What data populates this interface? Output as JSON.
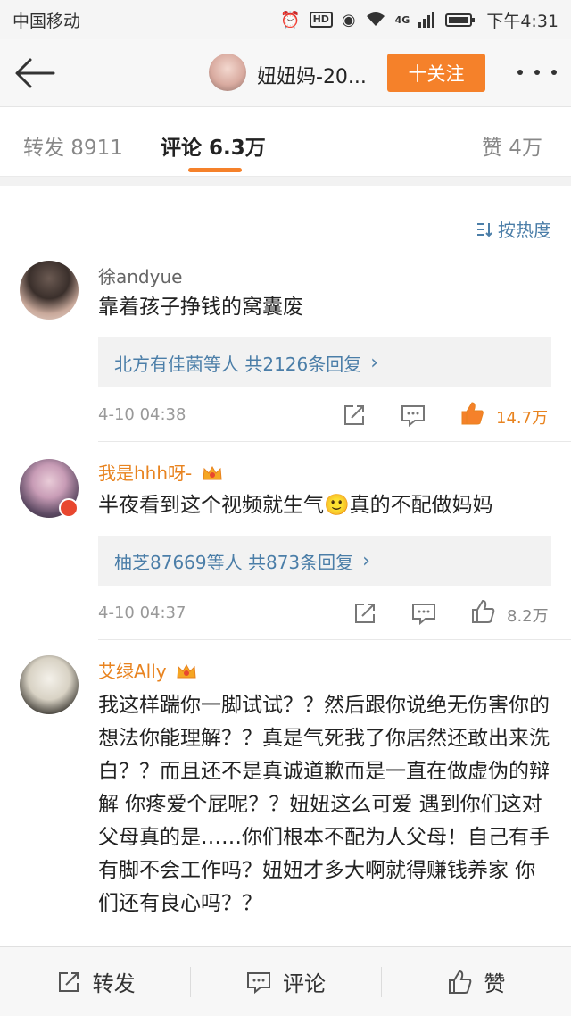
{
  "status_bar": {
    "carrier": "中国移动",
    "hd": "HD",
    "signal": "4G",
    "time": "下午4:31"
  },
  "nav": {
    "title": "妞妞妈-20...",
    "follow_label": "十关注"
  },
  "tabs": {
    "repost": "转发 8911",
    "comment": "评论 6.3万",
    "like": "赞 4万"
  },
  "sort": {
    "label": "按热度"
  },
  "comments": [
    {
      "username": "徐andyue",
      "text": "靠着孩子挣钱的窝囊废",
      "replies": "北方有佳菌等人  共2126条回复",
      "date": "4-10 04:38",
      "likes": "14.7万"
    },
    {
      "username": "我是hhh呀-",
      "text": "半夜看到这个视频就生气🙂真的不配做妈妈",
      "replies": "柚芝87669等人  共873条回复",
      "date": "4-10 04:37",
      "likes": "8.2万"
    },
    {
      "username": "艾绿Ally",
      "text": "我这样踹你一脚试试？？然后跟你说绝无伤害你的想法你能理解？？真是气死我了你居然还敢出来洗白？？而且还不是真诚道歉而是一直在做虚伪的辩解 你疼爱个屁呢？？妞妞这么可爱 遇到你们这对父母真的是……你们根本不配为人父母！自己有手有脚不会工作吗？妞妞才多大啊就得赚钱养家 你们还有良心吗？？"
    }
  ],
  "bottom_bar": {
    "repost": "转发",
    "comment": "评论",
    "like": "赞"
  },
  "colors": {
    "accent": "#f5812a",
    "link": "#4b7ea8",
    "vip_name": "#e8831f"
  }
}
